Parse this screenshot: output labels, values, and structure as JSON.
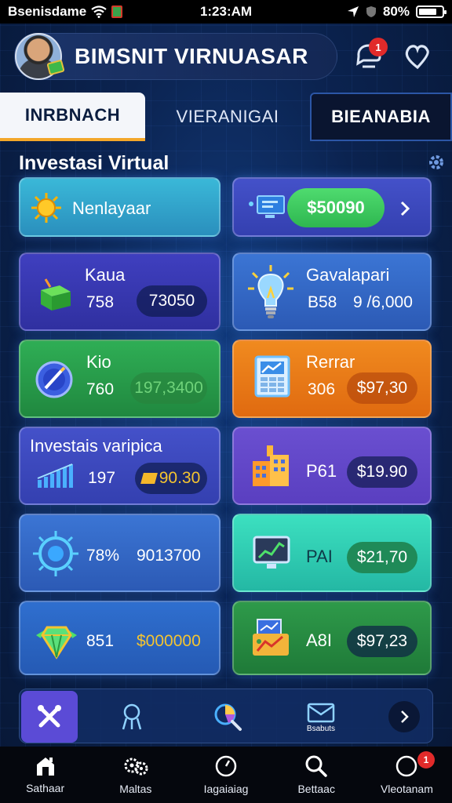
{
  "status_bar": {
    "carrier": "Bsenisdame",
    "time": "1:23:AM",
    "battery": "80%",
    "battery_level": 0.8
  },
  "header": {
    "title": "BIMSNIT VIRNUASAR",
    "notification_count": "1"
  },
  "tabs": [
    {
      "label": "INRBNACH",
      "active": true
    },
    {
      "label": "VIERANIGAI",
      "active": false
    },
    {
      "label": "BIEANABIA",
      "active": false
    }
  ],
  "section_title": "Investasi Virtual",
  "cards": {
    "c1": {
      "label": "Nenlayaar"
    },
    "c2": {
      "amount": "$50090"
    },
    "c3": {
      "label": "Kaua",
      "num": "758",
      "pill": "73050"
    },
    "c4": {
      "label": "Gavalapari",
      "num": "B58",
      "pill": "9 /6,000"
    },
    "c5": {
      "label": "Kio",
      "num": "760",
      "pill": "197,3400"
    },
    "c6": {
      "label": "Rerrar",
      "num": "306",
      "pill": "$97,30"
    },
    "c7": {
      "label": "Investais varipica",
      "num": "197",
      "pill": "90.30"
    },
    "c8": {
      "label": "P61",
      "pill": "$19.90"
    },
    "c9": {
      "num": "78%",
      "value": "9013700"
    },
    "c10": {
      "label": "PAI",
      "pill": "$21,70"
    },
    "c11": {
      "num": "851",
      "value": "$000000"
    },
    "c12": {
      "label": "A8I",
      "pill": "$97,23"
    }
  },
  "quick_bar": {
    "caption": "Bsabuts"
  },
  "bottom_nav": [
    {
      "label": "Sathaar",
      "icon": "home-icon"
    },
    {
      "label": "Maltas",
      "icon": "gears-icon"
    },
    {
      "label": "Iagaiaiag",
      "icon": "gauge-icon"
    },
    {
      "label": "Bettaac",
      "icon": "search-icon"
    },
    {
      "label": "Vleotanam",
      "icon": "profile-icon",
      "badge": "1"
    }
  ],
  "colors": {
    "background": "#0b2350",
    "active_tab_underline": "#f3a72a",
    "badge": "#e12a2a",
    "gold_text": "#f4c430"
  }
}
